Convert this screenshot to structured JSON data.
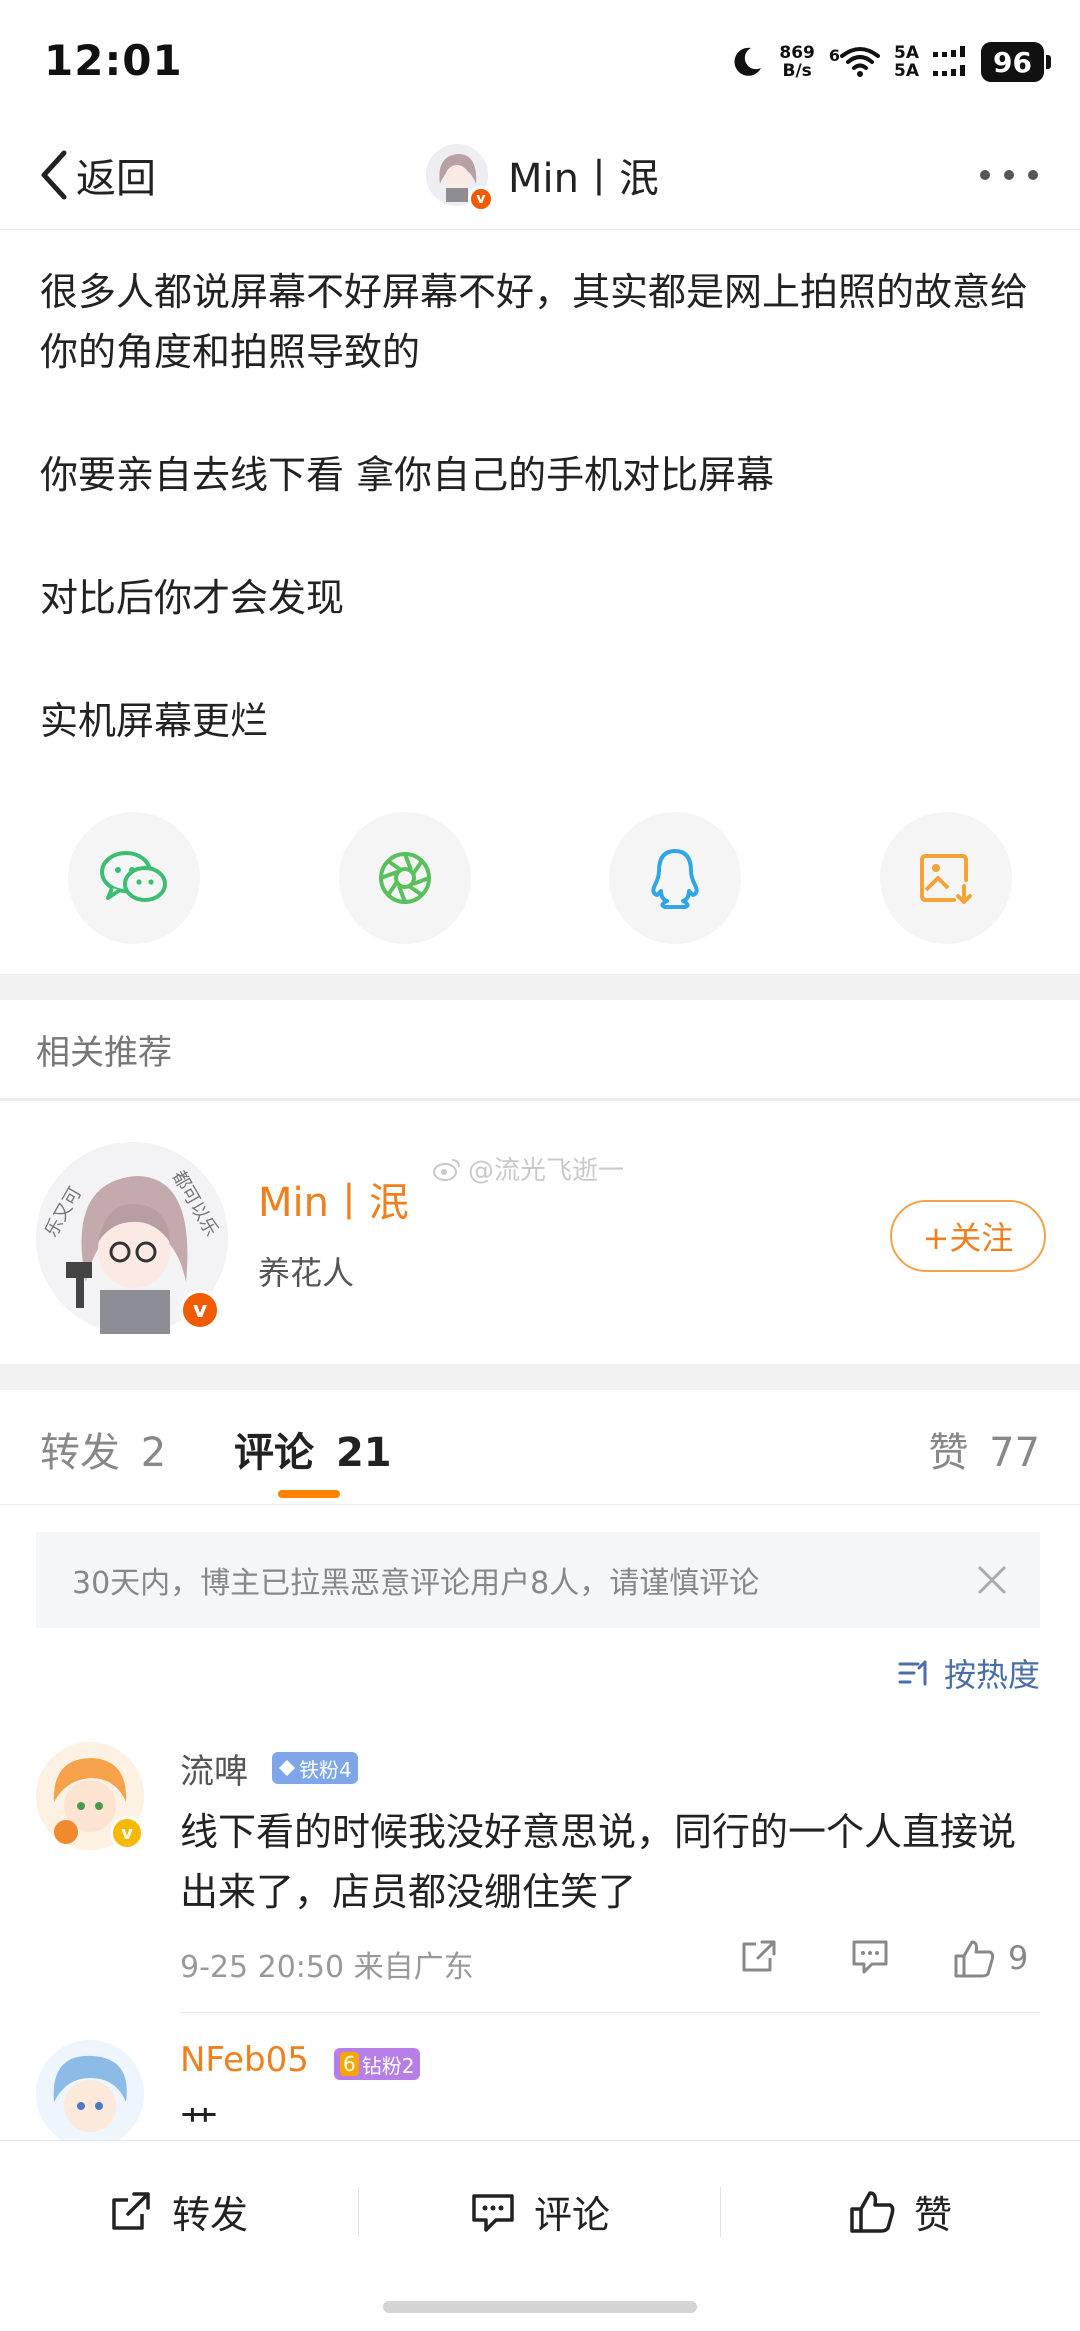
{
  "status_bar": {
    "time": "12:01",
    "net_speed_value": "869",
    "net_speed_unit": "B/s",
    "signal_top": "5A",
    "signal_bottom": "5A",
    "wifi_label": "6",
    "battery": "96"
  },
  "nav": {
    "back_label": "返回",
    "title": "Min丨泯"
  },
  "post": {
    "paragraphs": [
      "很多人都说屏幕不好屏幕不好，其实都是网上拍照的故意给你的角度和拍照导致的",
      "你要亲自去线下看 拿你自己的手机对比屏幕",
      "对比后你才会发现",
      "实机屏幕更烂"
    ]
  },
  "share": {
    "icons": [
      "wechat-icon",
      "moments-icon",
      "qq-icon",
      "save-image-icon"
    ],
    "colors": {
      "wechat": "#3dbd72",
      "moments": "#58c05c",
      "qq": "#2fa6e6",
      "save": "#f3a338"
    }
  },
  "related": {
    "label": "相关推荐",
    "author_name": "Min丨泯",
    "author_desc": "养花人",
    "avatar_text": "乐又可 都可以乐",
    "watermark": "@流光飞逝一",
    "follow_label": "+关注"
  },
  "tabs": {
    "repost_label": "转发",
    "repost_count": "2",
    "comment_label": "评论",
    "comment_count": "21",
    "like_label": "赞",
    "like_count": "77"
  },
  "notice": {
    "text": "30天内，博主已拉黑恶意评论用户8人，请谨慎评论"
  },
  "sort": {
    "label": "按热度"
  },
  "comments": [
    {
      "name": "流啤",
      "badge": "铁粉4",
      "text": "线下看的时候我没好意思说，同行的一个人直接说出来了，店员都没绷住笑了",
      "meta": "9-25 20:50 来自广东",
      "likes": "9"
    },
    {
      "name": "NFeb05",
      "badge": "钻粉2",
      "badge_level": "6",
      "text": "艹"
    }
  ],
  "bottom_bar": {
    "repost_label": "转发",
    "comment_label": "评论",
    "like_label": "赞"
  },
  "colors": {
    "accent": "#ff8200",
    "author_name": "#f07f1e",
    "link": "#4a6ea8",
    "verified": "#f05a00"
  }
}
